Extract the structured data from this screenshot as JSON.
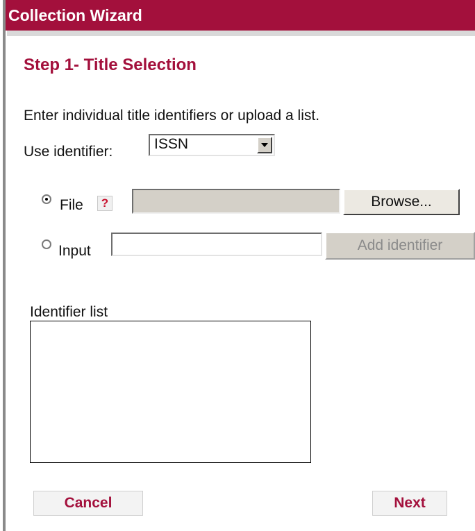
{
  "window": {
    "title": "Collection Wizard"
  },
  "step": {
    "title": "Step 1- Title Selection",
    "instruction": "Enter individual title identifiers or upload a list."
  },
  "identifier_select": {
    "label": "Use identifier:",
    "value": "ISSN"
  },
  "file_option": {
    "label": "File",
    "help_label": "?",
    "browse_label": "Browse...",
    "checked": true
  },
  "input_option": {
    "label": "Input",
    "add_label": "Add identifier",
    "value": "",
    "checked": false
  },
  "identifier_list": {
    "label": "Identifier list",
    "items": []
  },
  "actions": {
    "cancel_label": "Cancel",
    "next_label": "Next"
  },
  "colors": {
    "accent": "#a3103c",
    "help_mark": "#c8102e"
  }
}
